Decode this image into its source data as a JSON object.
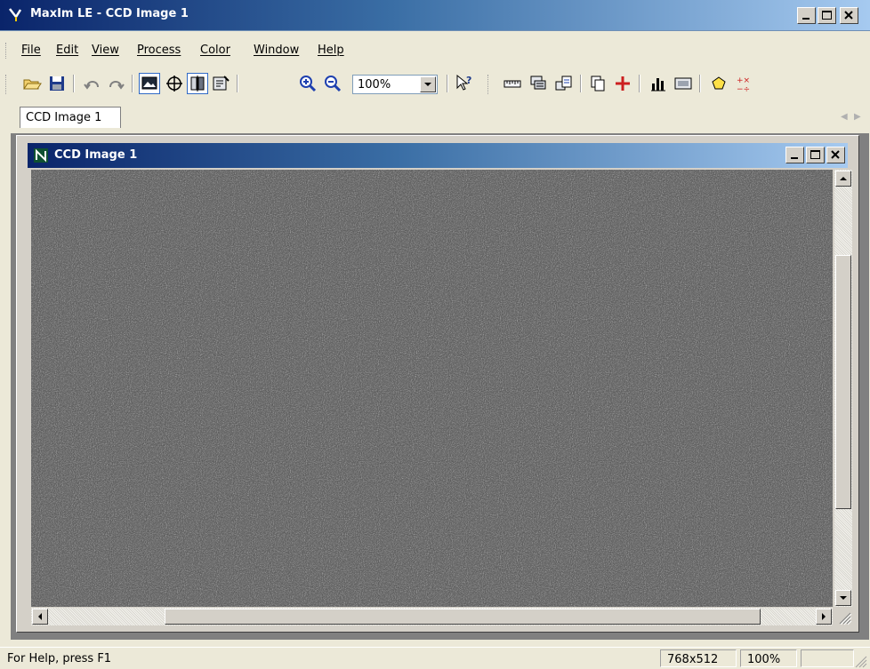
{
  "app": {
    "title": "MaxIm LE - CCD Image 1"
  },
  "menu": {
    "items": [
      {
        "label": "File"
      },
      {
        "label": "Edit"
      },
      {
        "label": "View"
      },
      {
        "label": "Process"
      },
      {
        "label": "Color"
      },
      {
        "label": "Window"
      },
      {
        "label": "Help"
      }
    ]
  },
  "toolbar": {
    "zoom_value": "100%",
    "icons": [
      "open-folder-icon",
      "save-icon",
      "undo-icon",
      "redo-icon",
      "image-view-icon",
      "crosshair-icon",
      "compare-icon",
      "settings-icon",
      "zoom-in-icon",
      "zoom-out-icon",
      "help-pointer-icon",
      "ruler-icon",
      "stack-icon",
      "export-icon",
      "copy-icon",
      "add-icon",
      "histogram-icon",
      "display-icon",
      "star-icon",
      "math-icon"
    ]
  },
  "tabs": {
    "document_tab": "CCD Image 1"
  },
  "child_window": {
    "title": "CCD Image 1"
  },
  "status": {
    "help_text": "For Help, press F1",
    "dimensions": "768x512",
    "zoom": "100%"
  },
  "colors": {
    "title_gradient_start": "#0a246a",
    "title_gradient_end": "#a6caf0",
    "chrome": "#ece9d8",
    "image_background": "#141414"
  }
}
